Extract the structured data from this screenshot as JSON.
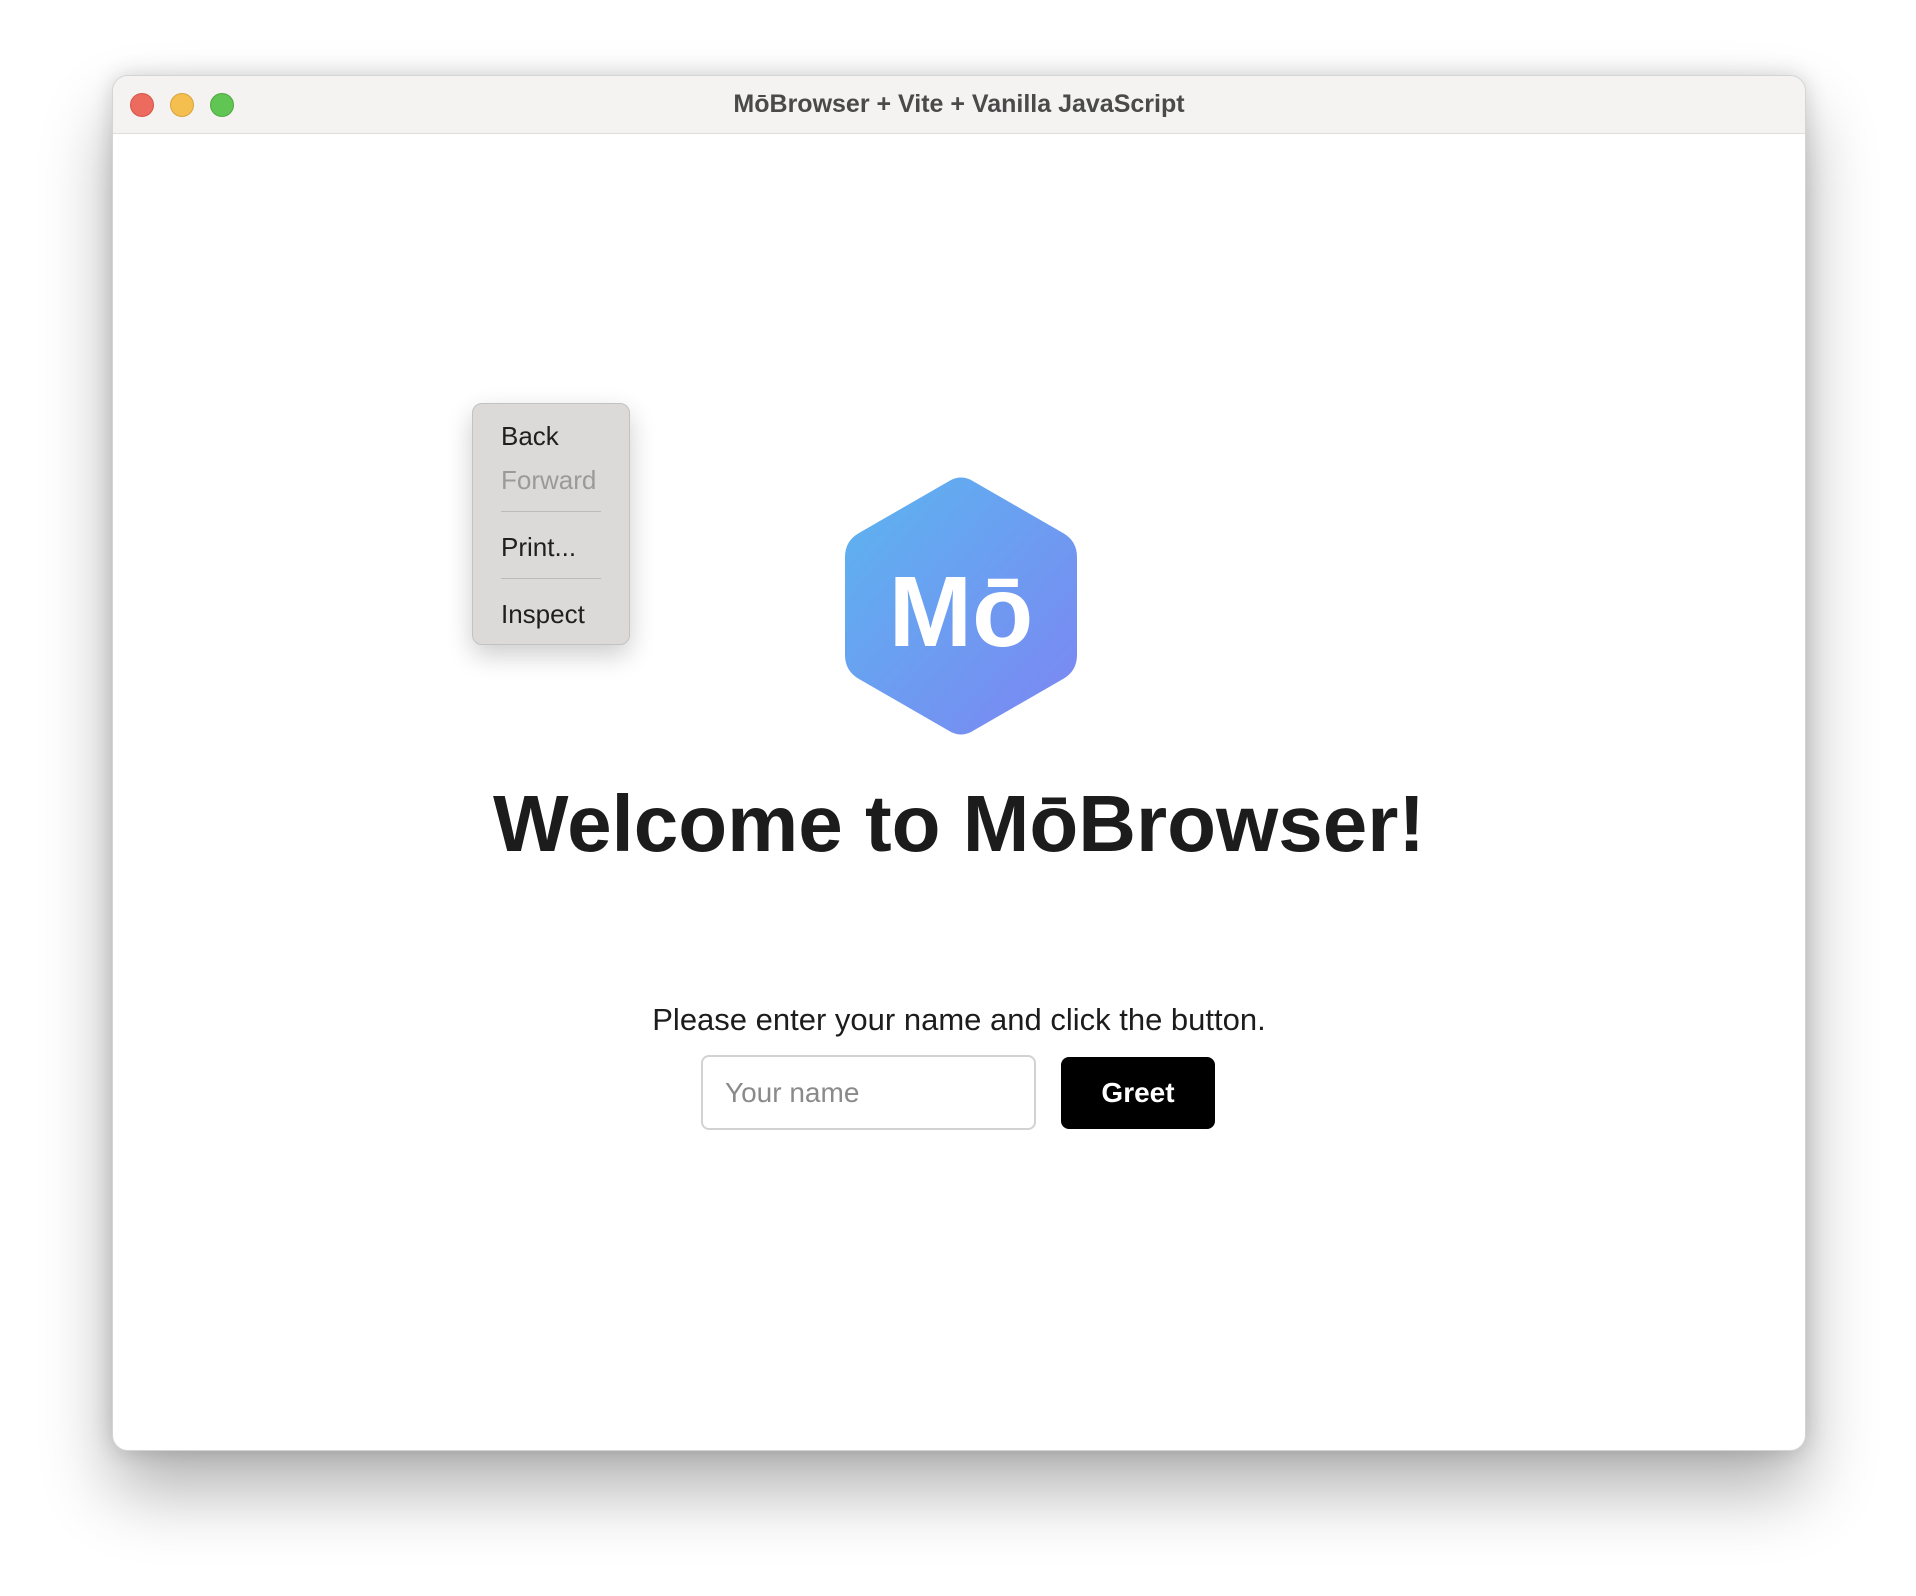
{
  "window": {
    "title": "MōBrowser + Vite + Vanilla JavaScript"
  },
  "logo": {
    "text": "Mō",
    "gradient_start": "#5bb5f0",
    "gradient_end": "#7d85f2"
  },
  "main": {
    "heading": "Welcome to MōBrowser!",
    "prompt": "Please enter your name and click the button.",
    "name_placeholder": "Your name",
    "greet_label": "Greet"
  },
  "context_menu": {
    "items": [
      {
        "label": "Back",
        "enabled": true
      },
      {
        "label": "Forward",
        "enabled": false
      },
      {
        "label": "Print...",
        "enabled": true
      },
      {
        "label": "Inspect",
        "enabled": true
      }
    ]
  },
  "colors": {
    "close": "#ec6a5e",
    "minimize": "#f4bf4f",
    "maximize": "#61c554",
    "button_bg": "#000000"
  }
}
